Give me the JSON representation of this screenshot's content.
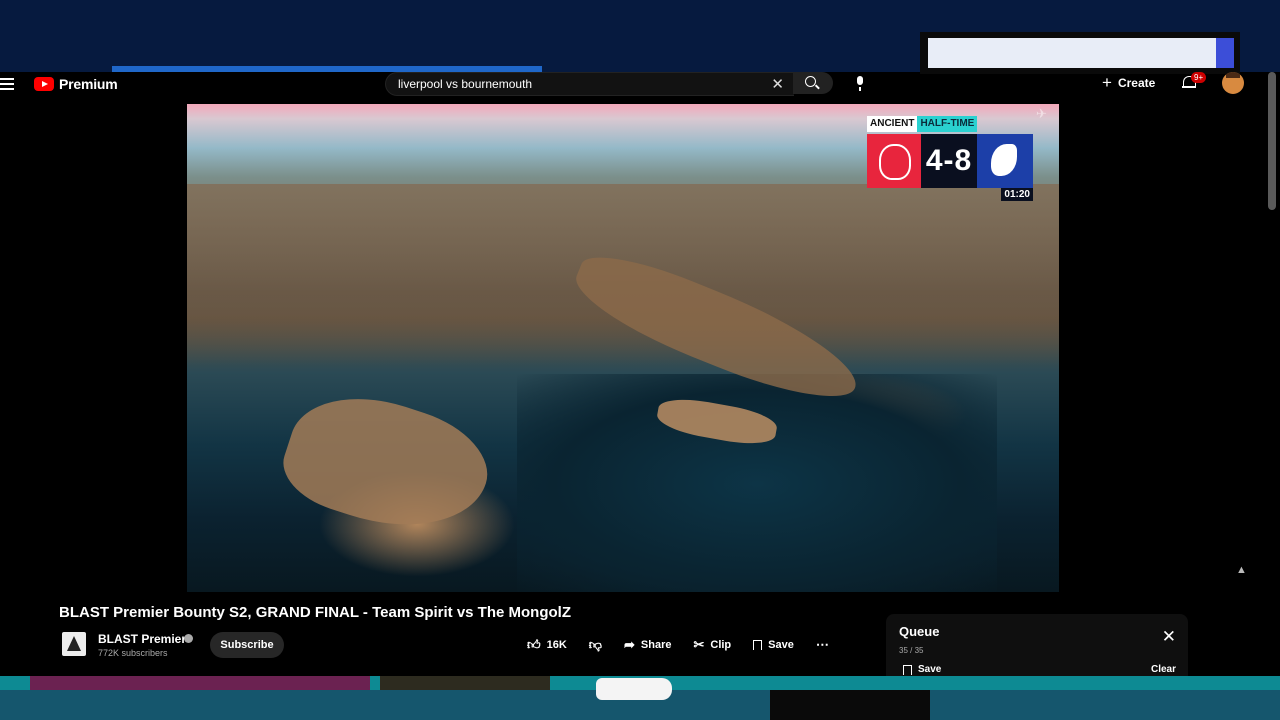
{
  "masthead": {
    "brand": "Premium",
    "search_query": "liverpool vs bournemouth",
    "create_label": "Create",
    "notification_badge": "9+"
  },
  "scorebug": {
    "map": "ANCIENT",
    "phase": "HALF-TIME",
    "score": "4-8",
    "timer": "01:20"
  },
  "video": {
    "title": "BLAST Premier Bounty S2, GRAND FINAL - Team Spirit vs The MongolZ",
    "channel_name": "BLAST Premier",
    "subscribers": "772K subscribers",
    "subscribe_label": "Subscribe",
    "likes": "16K",
    "share_label": "Share",
    "clip_label": "Clip",
    "save_label": "Save"
  },
  "queue": {
    "title": "Queue",
    "count": "35 / 35",
    "save_label": "Save",
    "clear_label": "Clear"
  },
  "colors": {
    "brand_red": "#ff0000",
    "team1": "#e8253d",
    "team2": "#1c3fa8",
    "phase_accent": "#2ad1d0"
  }
}
